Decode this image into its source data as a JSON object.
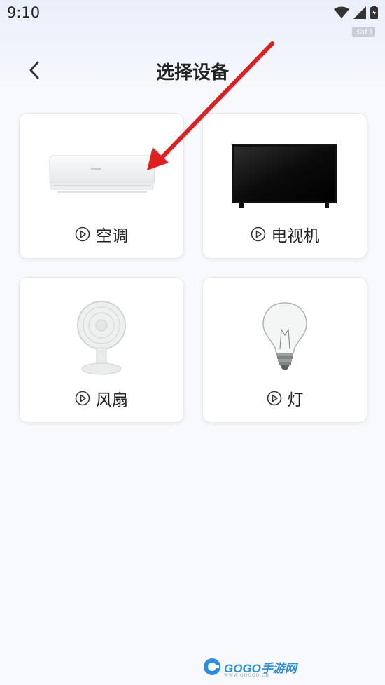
{
  "status_bar": {
    "time": "9:10",
    "tag": "3af3"
  },
  "header": {
    "title": "选择设备"
  },
  "devices": [
    {
      "label": "空调"
    },
    {
      "label": "电视机"
    },
    {
      "label": "风扇"
    },
    {
      "label": "灯"
    }
  ],
  "watermark": {
    "brand": "GOGO手游网",
    "url": "WWW.GOGOO.CN"
  },
  "colors": {
    "annotation_arrow": "#e02020",
    "background": "#f8f9fd",
    "card": "#ffffff"
  },
  "icons": [
    "back-arrow-icon",
    "wifi-icon",
    "signal-icon",
    "battery-icon",
    "play-circle-icon"
  ]
}
